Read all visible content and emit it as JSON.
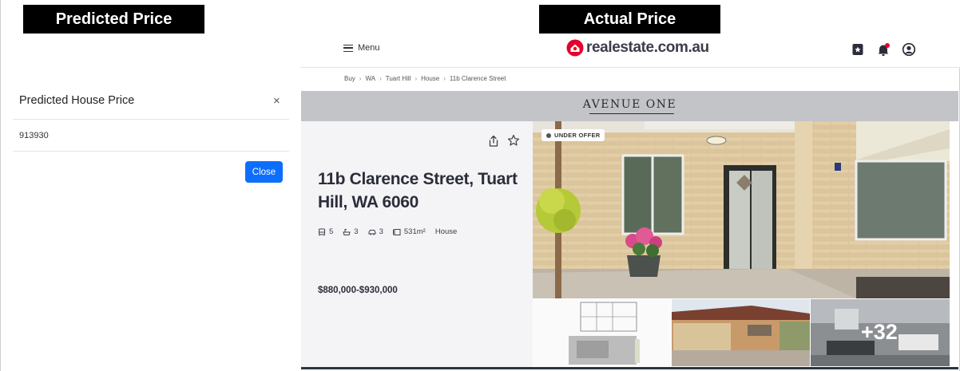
{
  "labels": {
    "predicted": "Predicted Price",
    "actual": "Actual Price"
  },
  "modal": {
    "title": "Predicted House Price",
    "close_x": "×",
    "value": "913930",
    "close_button": "Close",
    "button_color": "#0d6efd"
  },
  "site": {
    "menu_label": "Menu",
    "logo_text": "realestate.com.au",
    "brand_color": "#e4002b",
    "nav_icons": [
      "saved-listings-icon",
      "notifications-icon",
      "account-icon"
    ],
    "breadcrumb": [
      "Buy",
      "WA",
      "Tuart Hill",
      "House",
      "11b Clarence Street"
    ],
    "banner_text": "AVENUE ONE",
    "listing": {
      "address": "11b Clarence Street, Tuart Hill, WA 6060",
      "bedrooms": "5",
      "bathrooms": "3",
      "parking": "3",
      "land_size": "531m²",
      "property_type": "House",
      "price": "$880,000-$930,000",
      "status_badge": "UNDER OFFER",
      "more_photos": "+32"
    }
  }
}
